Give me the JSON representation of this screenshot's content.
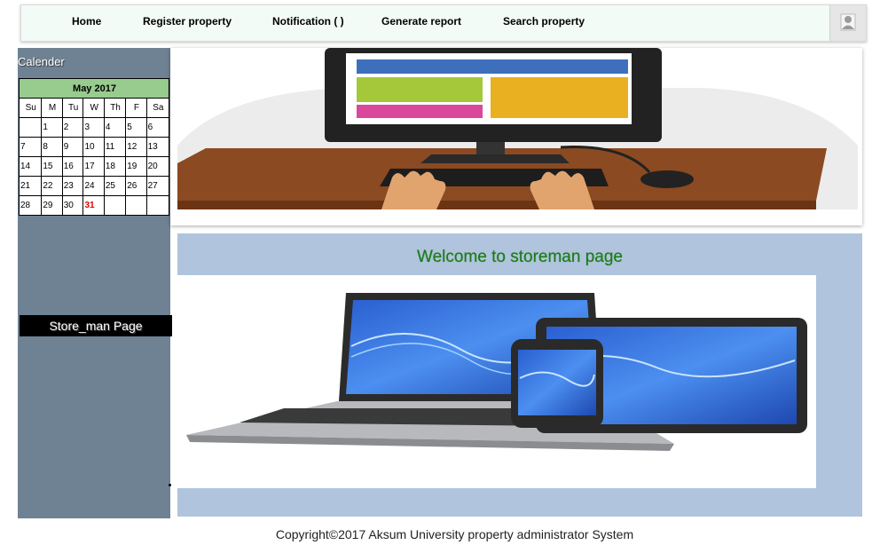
{
  "nav": {
    "items": [
      "Home",
      "Register property",
      "Notification ( )",
      "Generate report",
      "Search property"
    ],
    "user_icon": "user-avatar-icon"
  },
  "sidebar": {
    "calendar_caption": "Calender",
    "calendar": {
      "month": "May 2017",
      "weekdays": [
        "Su",
        "M",
        "Tu",
        "W",
        "Th",
        "F",
        "Sa"
      ],
      "weeks": [
        [
          "",
          "1",
          "2",
          "3",
          "4",
          "5",
          "6"
        ],
        [
          "7",
          "8",
          "9",
          "10",
          "11",
          "12",
          "13"
        ],
        [
          "14",
          "15",
          "16",
          "17",
          "18",
          "19",
          "20"
        ],
        [
          "21",
          "22",
          "23",
          "24",
          "25",
          "26",
          "27"
        ],
        [
          "28",
          "29",
          "30",
          "31",
          "",
          "",
          ""
        ]
      ],
      "highlight_day": "31",
      "highlight_color": "#e00000"
    },
    "page_label": "Store_man Page"
  },
  "main": {
    "welcome": "Welcome to storeman page"
  },
  "footer": {
    "copyright": "Copyright©2017 Aksum University property administrator System"
  },
  "colors": {
    "sidebar": "#6e8294",
    "main_panel": "#b0c4de",
    "calendar_header": "#98cc8e",
    "welcome_text": "#1a7a1a"
  }
}
